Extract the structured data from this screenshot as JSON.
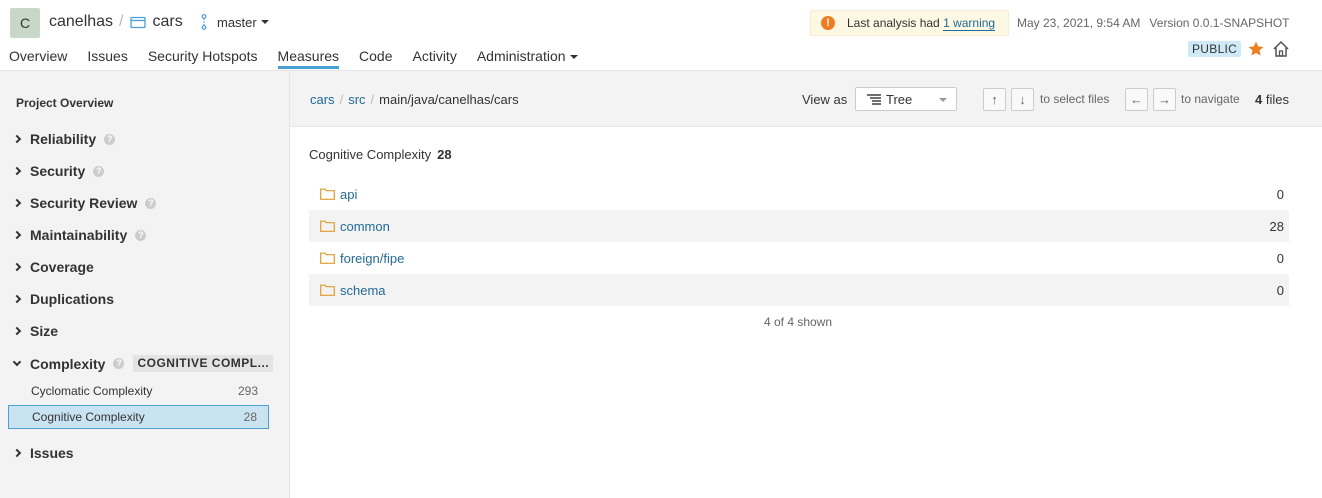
{
  "header": {
    "avatar_letter": "C",
    "org": "canelhas",
    "project": "cars",
    "branch": "master",
    "tabs": [
      {
        "label": "Overview"
      },
      {
        "label": "Issues"
      },
      {
        "label": "Security Hotspots"
      },
      {
        "label": "Measures",
        "active": true
      },
      {
        "label": "Code"
      },
      {
        "label": "Activity"
      },
      {
        "label": "Administration",
        "dropdown": true
      }
    ],
    "warning": {
      "prefix": "Last analysis had",
      "link": "1 warning",
      "icon": "exclamation-icon"
    },
    "date": "May 23, 2021, 9:54 AM",
    "version": "Version 0.0.1-SNAPSHOT",
    "visibility": "PUBLIC",
    "accent_color": "#4b9fd5",
    "star_color": "#ed7d20"
  },
  "sidebar": {
    "title": "Project Overview",
    "facets": [
      {
        "label": "Reliability",
        "help": true
      },
      {
        "label": "Security",
        "help": true
      },
      {
        "label": "Security Review",
        "help": true
      },
      {
        "label": "Maintainability",
        "help": true
      },
      {
        "label": "Coverage",
        "help": false
      },
      {
        "label": "Duplications",
        "help": false
      },
      {
        "label": "Size",
        "help": false
      },
      {
        "label": "Complexity",
        "help": true,
        "open": true,
        "badge": "COGNITIVE COMPL..."
      },
      {
        "label": "Issues",
        "help": false
      }
    ],
    "complexity_items": [
      {
        "label": "Cyclomatic Complexity",
        "value": "293"
      },
      {
        "label": "Cognitive Complexity",
        "value": "28",
        "selected": true
      }
    ]
  },
  "toolbar": {
    "path": [
      "cars",
      "src",
      "main/java/canelhas/cars"
    ],
    "view_as_label": "View as",
    "view_as_value": "Tree",
    "select_hint": "to select files",
    "navigate_hint": "to navigate",
    "file_count": "4",
    "file_count_suffix": "files",
    "keys": {
      "up": "↑",
      "down": "↓",
      "left": "←",
      "right": "→"
    }
  },
  "main": {
    "metric_label": "Cognitive Complexity",
    "metric_value": "28",
    "rows": [
      {
        "name": "api",
        "value": "0"
      },
      {
        "name": "common",
        "value": "28"
      },
      {
        "name": "foreign/fipe",
        "value": "0"
      },
      {
        "name": "schema",
        "value": "0"
      }
    ],
    "shown": "4 of 4 shown"
  }
}
